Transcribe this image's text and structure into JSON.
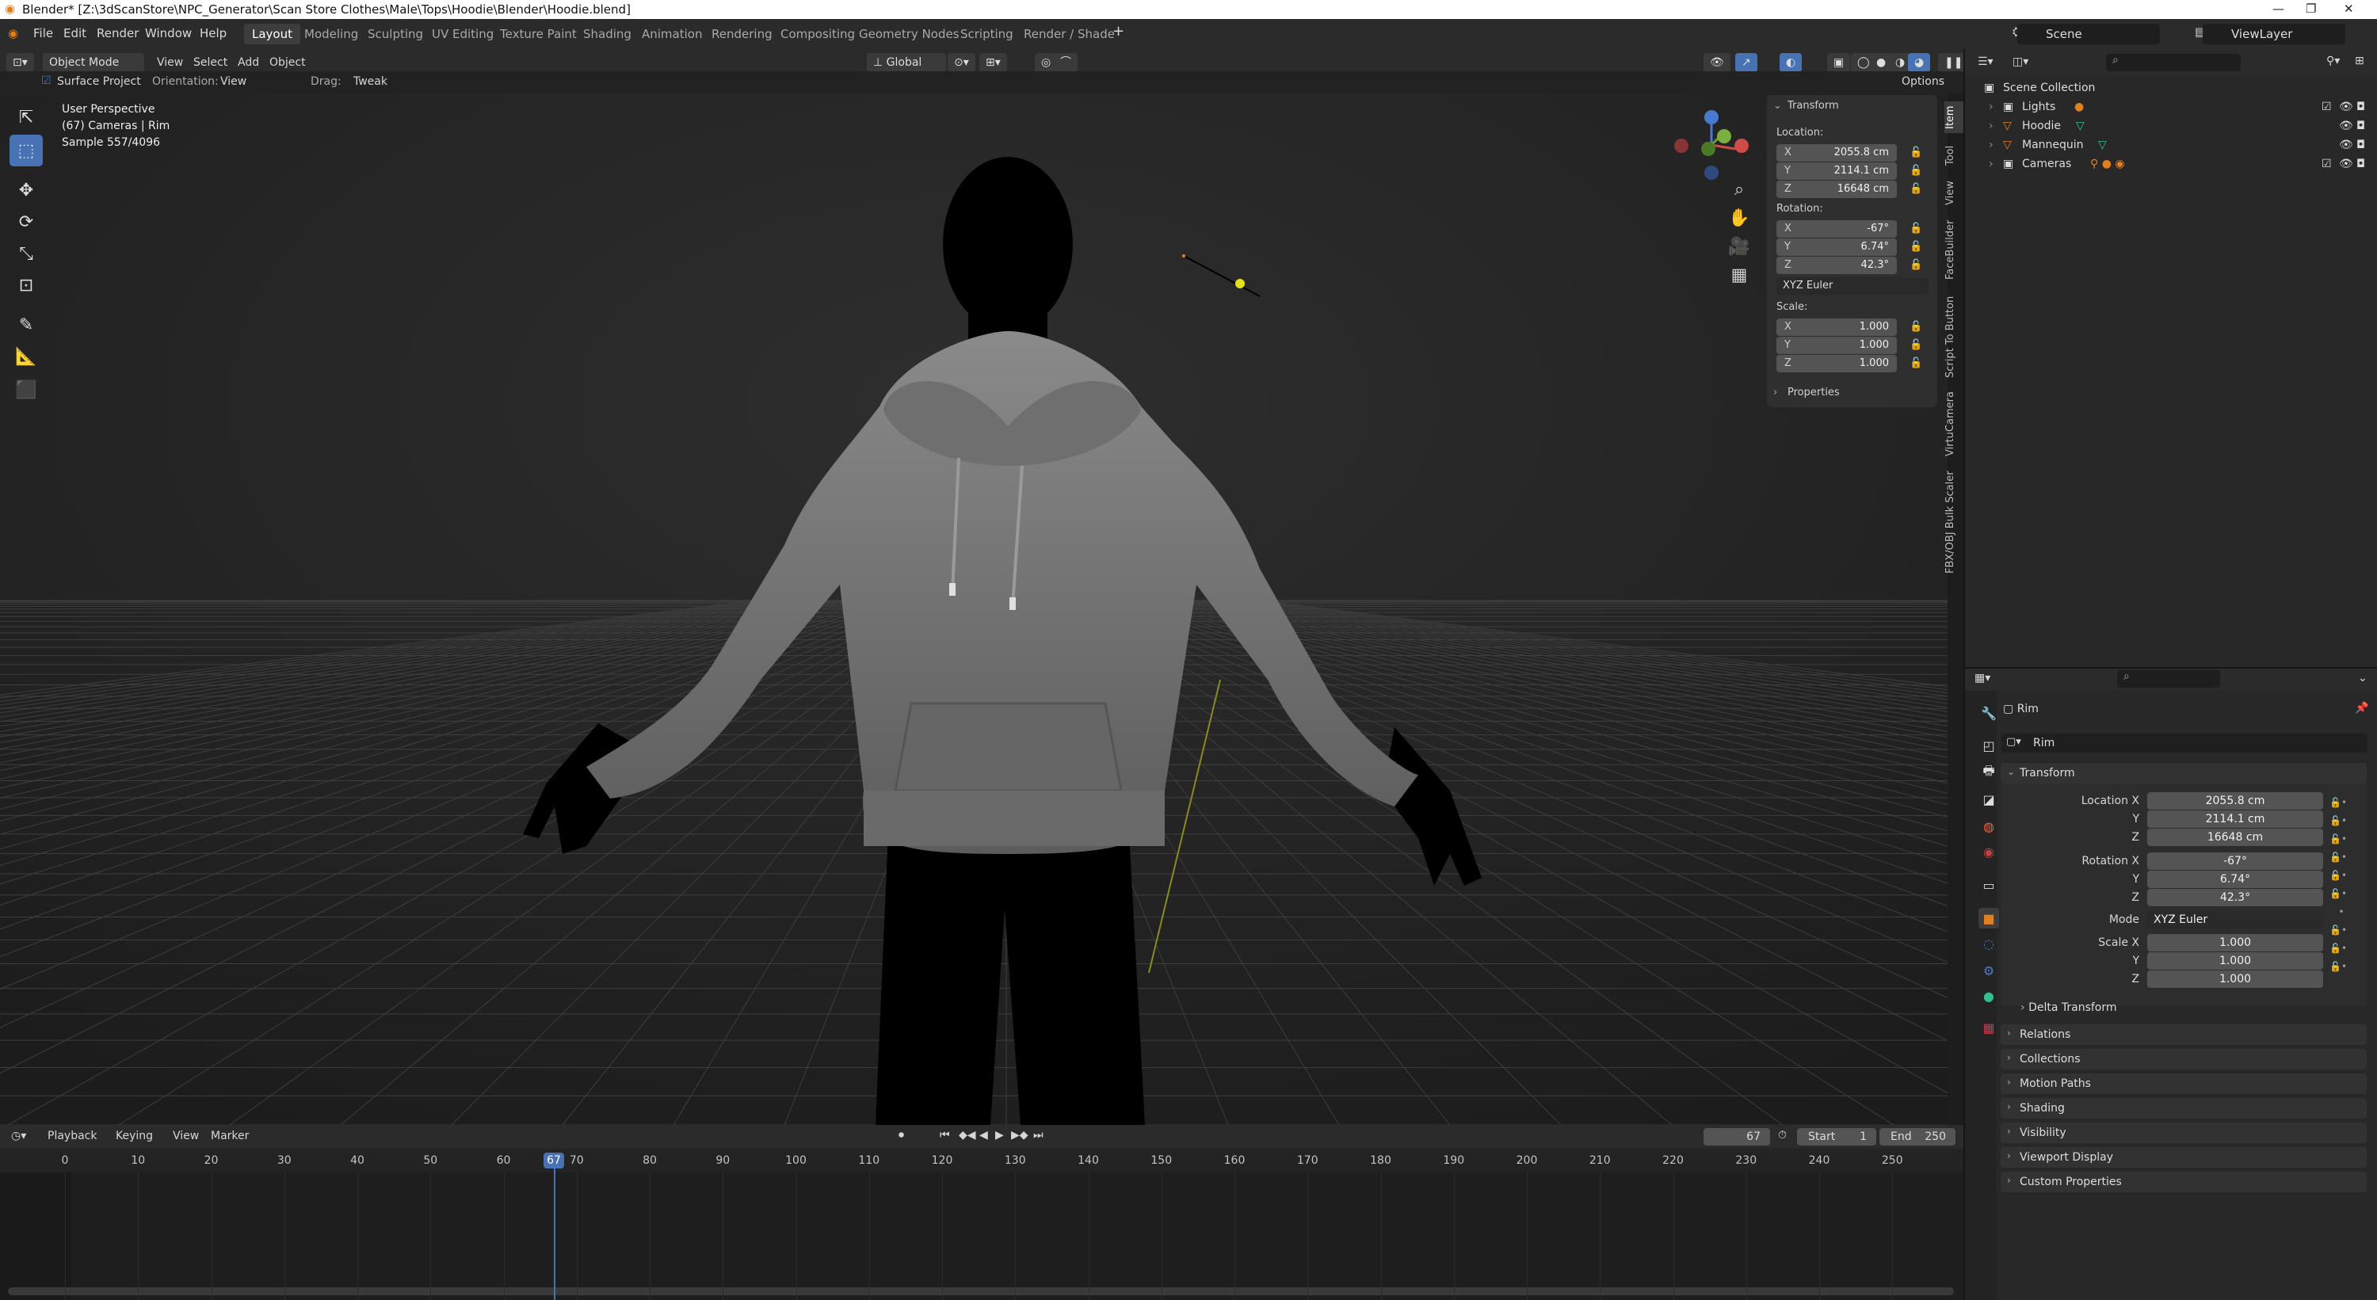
{
  "window": {
    "title": "Blender* [Z:\\3dScanStore\\NPC_Generator\\Scan Store Clothes\\Male\\Tops\\Hoodie\\Blender\\Hoodie.blend]"
  },
  "menu": [
    "File",
    "Edit",
    "Render",
    "Window",
    "Help"
  ],
  "workspaces": [
    "Layout",
    "Modeling",
    "Sculpting",
    "UV Editing",
    "Texture Paint",
    "Shading",
    "Animation",
    "Rendering",
    "Compositing",
    "Geometry Nodes",
    "Scripting",
    "Render / Shade"
  ],
  "active_workspace": "Layout",
  "scene_name": "Scene",
  "view_layer": "ViewLayer",
  "viewport_header": {
    "mode": "Object Mode",
    "menus": [
      "View",
      "Select",
      "Add",
      "Object"
    ],
    "transform_orientation": "Global",
    "surface_project": "Surface Project",
    "orientation_label": "Orientation:",
    "orientation_value": "View",
    "drag_label": "Drag:",
    "drag_value": "Tweak",
    "options": "Options"
  },
  "viewport_info": {
    "line1": "User Perspective",
    "line2": "(67) Cameras | Rim",
    "line3": "Sample 557/4096"
  },
  "npanel": {
    "transform": "Transform",
    "location_label": "Location:",
    "loc": {
      "x": "2055.8 cm",
      "y": "2114.1 cm",
      "z": "16648 cm"
    },
    "rotation_label": "Rotation:",
    "rot": {
      "x": "-67°",
      "y": "6.74°",
      "z": "42.3°"
    },
    "rot_mode": "XYZ Euler",
    "scale_label": "Scale:",
    "scale": {
      "x": "1.000",
      "y": "1.000",
      "z": "1.000"
    },
    "properties": "Properties",
    "axis_x": "X",
    "axis_y": "Y",
    "axis_z": "Z"
  },
  "vertical_tabs": [
    "Item",
    "Tool",
    "View",
    "FaceBuilder",
    "Script To Button",
    "VirtuCamera",
    "FBX/OBJ Bulk Scaler"
  ],
  "outliner": {
    "root": "Scene Collection",
    "items": [
      "Lights",
      "Hoodie",
      "Mannequin",
      "Cameras"
    ]
  },
  "properties": {
    "object_name": "Rim",
    "data_name": "Rim",
    "transform": "Transform",
    "location_x_label": "Location X",
    "rotation_x_label": "Rotation X",
    "scale_x_label": "Scale X",
    "y_label": "Y",
    "z_label": "Z",
    "mode_label": "Mode",
    "mode_value": "XYZ Euler",
    "loc": [
      "2055.8 cm",
      "2114.1 cm",
      "16648 cm"
    ],
    "rot": [
      "-67°",
      "6.74°",
      "42.3°"
    ],
    "scale": [
      "1.000",
      "1.000",
      "1.000"
    ],
    "subsections": [
      "Delta Transform",
      "Relations",
      "Collections",
      "Motion Paths",
      "Shading",
      "Visibility",
      "Viewport Display",
      "Custom Properties"
    ]
  },
  "timeline": {
    "menus": [
      "Playback",
      "Keying",
      "View",
      "Marker"
    ],
    "current_frame": "67",
    "start_label": "Start",
    "start": "1",
    "end_label": "End",
    "end": "250",
    "ticks": [
      "0",
      "10",
      "20",
      "30",
      "40",
      "50",
      "60",
      "70",
      "80",
      "90",
      "100",
      "110",
      "120",
      "130",
      "140",
      "150",
      "160",
      "170",
      "180",
      "190",
      "200",
      "210",
      "220",
      "230",
      "240",
      "250"
    ]
  },
  "colors": {
    "accent": "#4772b3",
    "header": "#2b2b2b",
    "viewport_bg": "#3a3a3a",
    "playhead": "#4772b3"
  }
}
